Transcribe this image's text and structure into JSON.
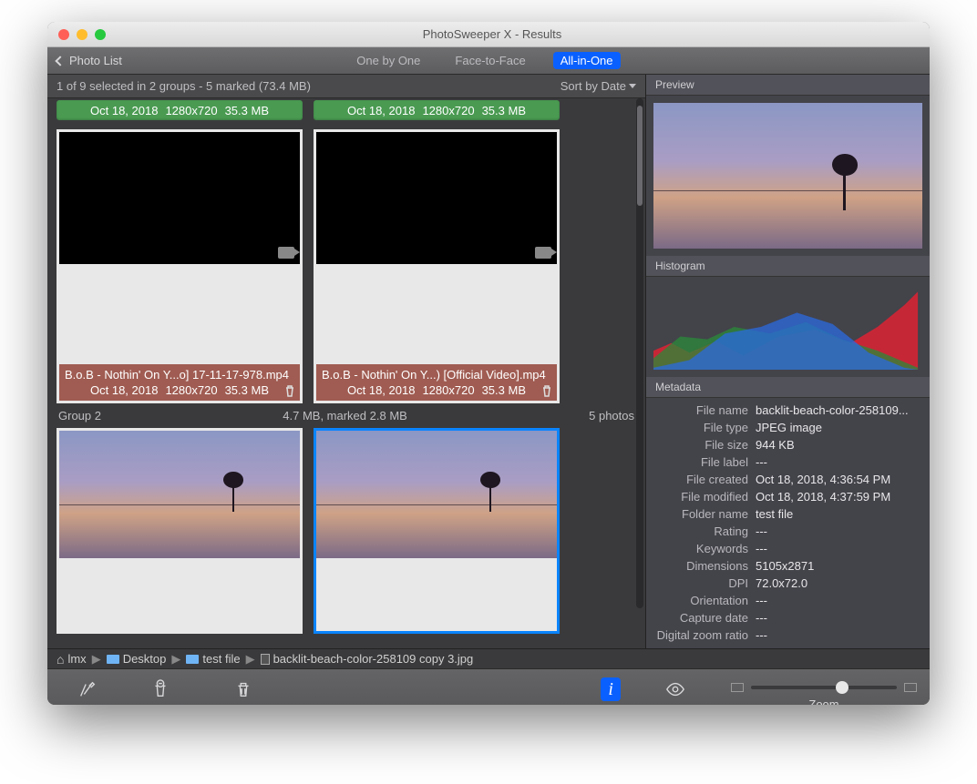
{
  "title": "PhotoSweeper X - Results",
  "back_label": "Photo List",
  "view_tabs": [
    "One by One",
    "Face-to-Face",
    "All-in-One"
  ],
  "active_tab": 2,
  "infobar": "1 of 9 selected in 2 groups - 5 marked (73.4 MB)",
  "sort_label": "Sort by Date",
  "greenbars": [
    {
      "date": "Oct 18, 2018",
      "dim": "1280x720",
      "size": "35.3 MB"
    },
    {
      "date": "Oct 18, 2018",
      "dim": "1280x720",
      "size": "35.3 MB"
    }
  ],
  "cards": [
    {
      "name": "B.o.B - Nothin' On Y...o] 17-11-17-978.mp4",
      "date": "Oct 18, 2018",
      "dim": "1280x720",
      "size": "35.3 MB"
    },
    {
      "name": "B.o.B - Nothin' On Y...) [Official Video].mp4",
      "date": "Oct 18, 2018",
      "dim": "1280x720",
      "size": "35.3 MB"
    }
  ],
  "group2": {
    "name": "Group 2",
    "mid": "4.7 MB, marked 2.8 MB",
    "count": "5 photos"
  },
  "path": {
    "user": "lmx",
    "segs": [
      "Desktop",
      "test file"
    ],
    "file": "backlit-beach-color-258109 copy 3.jpg"
  },
  "bottom": {
    "auto": "Auto Mark",
    "unmark": "Unmark",
    "trash": "Trash Marked",
    "info": "Info",
    "ql": "Quick Look",
    "zoom": "Zoom"
  },
  "right": {
    "preview": "Preview",
    "histogram": "Histogram",
    "metadata": "Metadata",
    "rows": [
      {
        "k": "File name",
        "v": "backlit-beach-color-258109..."
      },
      {
        "k": "File type",
        "v": "JPEG image"
      },
      {
        "k": "File size",
        "v": "944 KB"
      },
      {
        "k": "File label",
        "v": "---"
      },
      {
        "k": "File created",
        "v": "Oct 18, 2018, 4:36:54 PM"
      },
      {
        "k": "File modified",
        "v": "Oct 18, 2018, 4:37:59 PM"
      },
      {
        "k": "Folder name",
        "v": "test file"
      },
      {
        "k": "Rating",
        "v": "---"
      },
      {
        "k": "Keywords",
        "v": "---"
      },
      {
        "k": "Dimensions",
        "v": "5105x2871"
      },
      {
        "k": "DPI",
        "v": "72.0x72.0"
      },
      {
        "k": "Orientation",
        "v": "---"
      },
      {
        "k": "Capture date",
        "v": "---"
      },
      {
        "k": "Digital zoom ratio",
        "v": "---"
      }
    ]
  }
}
